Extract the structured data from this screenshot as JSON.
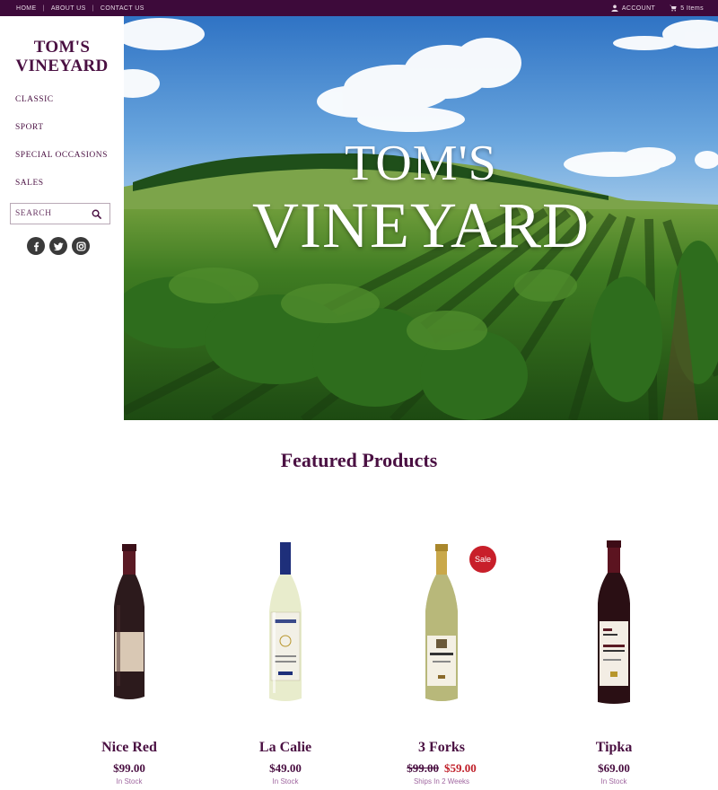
{
  "topbar": {
    "nav": [
      "HOME",
      "ABOUT US",
      "CONTACT US"
    ],
    "account_label": "ACCOUNT",
    "cart_label": "5 Items"
  },
  "sidebar": {
    "logo_line1": "TOM'S",
    "logo_line2": "VINEYARD",
    "menu": [
      "CLASSIC",
      "SPORT",
      "SPECIAL OCCASIONS",
      "SALES"
    ],
    "search_placeholder": "SEARCH",
    "social": [
      "facebook-icon",
      "twitter-icon",
      "instagram-icon"
    ]
  },
  "hero": {
    "line1": "TOM'S",
    "line2": "VINEYARD"
  },
  "featured": {
    "title": "Featured Products",
    "products": [
      {
        "name": "Nice Red",
        "price": "$99.00",
        "stock": "In Stock"
      },
      {
        "name": "La Calie",
        "price": "$49.00",
        "stock": "In Stock"
      },
      {
        "name": "3 Forks",
        "old_price": "$99.00",
        "sale_price": "$59.00",
        "badge": "Sale",
        "stock": "Ships In 2 Weeks"
      },
      {
        "name": "Tipka",
        "price": "$69.00",
        "stock": "In Stock"
      }
    ]
  },
  "colors": {
    "brand": "#4a1042",
    "topbar": "#3d0a3a",
    "sale": "#c81f2a"
  }
}
